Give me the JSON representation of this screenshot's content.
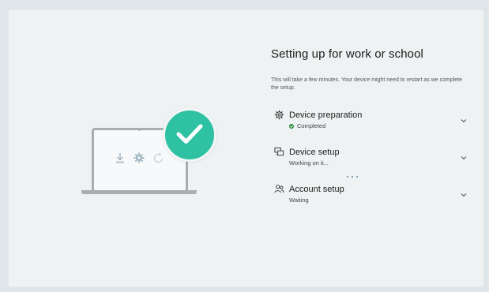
{
  "setup": {
    "title": "Setting up for work or school",
    "subtitle": "This will take a few minutes. Your device might need to restart as we complete the setup."
  },
  "steps": [
    {
      "title": "Device preparation",
      "status": "Completed",
      "icon": "gear-icon"
    },
    {
      "title": "Device setup",
      "status": "Working on it...",
      "icon": "devices-icon"
    },
    {
      "title": "Account setup",
      "status": "Waiting",
      "icon": "people-icon"
    }
  ],
  "colors": {
    "accent": "#2ec1a2",
    "completed": "#2a8a3a",
    "laptop": "#a7adb1"
  },
  "illustration": {
    "badge_icon": "checkmark-icon",
    "icons": [
      "download-icon",
      "gear-icon",
      "refresh-icon"
    ]
  }
}
